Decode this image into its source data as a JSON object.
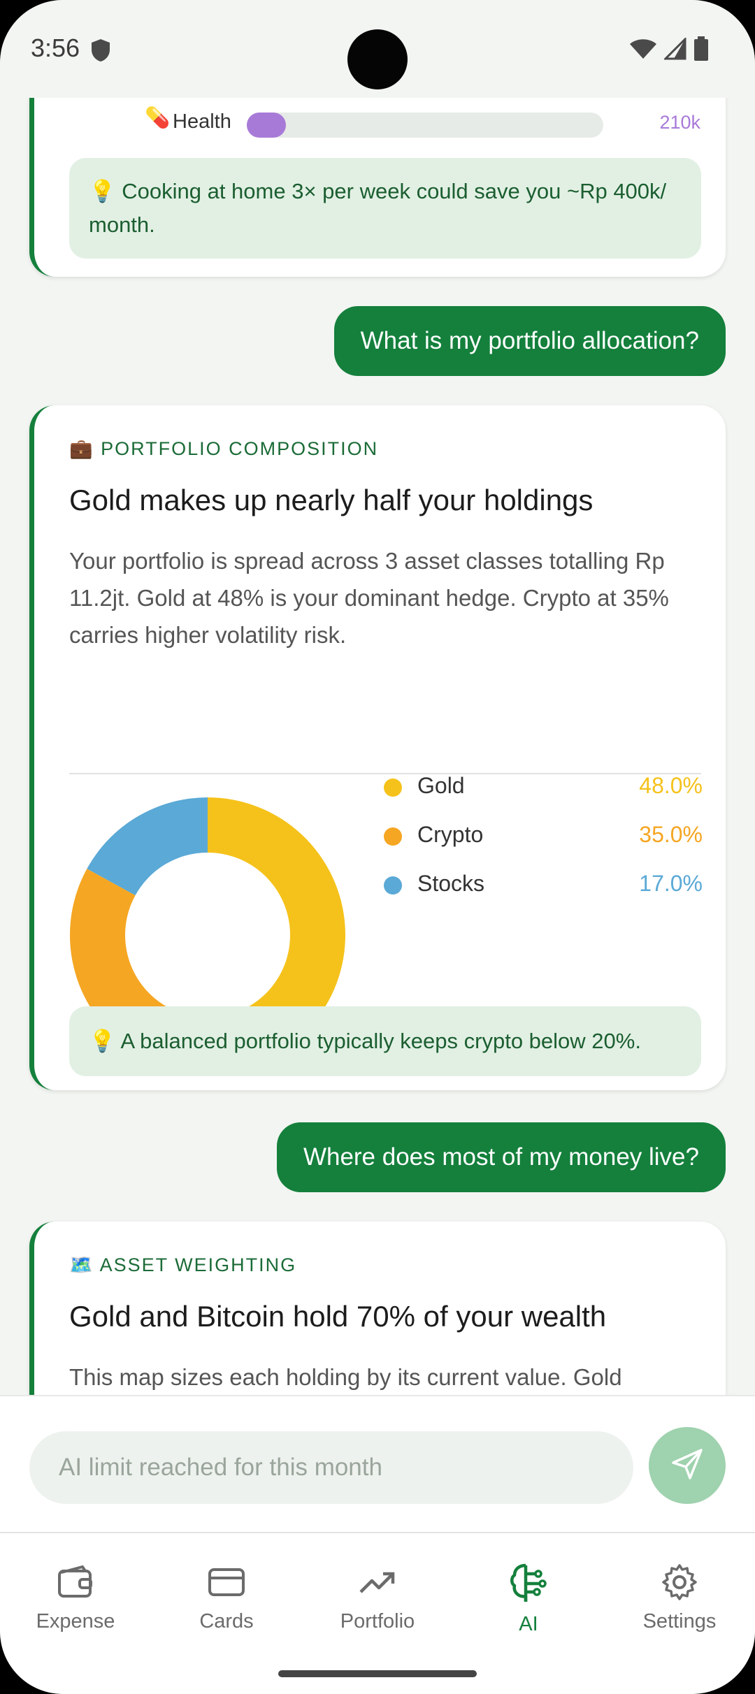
{
  "status": {
    "time": "3:56"
  },
  "top_card": {
    "category_icon": "pill-icon",
    "category_label": "Health",
    "category_amount": "210k",
    "category_fill": 0.11,
    "category_color": "#a87ad8",
    "tip_icon": "💡",
    "tip_text": "Cooking at home 3× per week could save you ~Rp 400k/ month."
  },
  "messages": {
    "user_1": "What is my portfolio allocation?",
    "user_2": "Where does most of my money live?"
  },
  "portfolio_card": {
    "eyebrow_icon": "💼",
    "eyebrow": "PORTFOLIO COMPOSITION",
    "title": "Gold makes up nearly half your holdings",
    "body": "Your portfolio is spread across 3 asset classes totalling Rp 11.2jt. Gold at 48% is your dominant hedge. Crypto at 35% carries higher volatility risk.",
    "tip_icon": "💡",
    "tip_text": "A balanced portfolio typically keeps crypto below 20%."
  },
  "chart_data": {
    "type": "pie",
    "donut": true,
    "categories": [
      "Gold",
      "Crypto",
      "Stocks"
    ],
    "values": [
      48.0,
      35.0,
      17.0
    ],
    "value_labels": [
      "48.0%",
      "35.0%",
      "17.0%"
    ],
    "colors": [
      "#f5c21b",
      "#f5a623",
      "#5aa9d6"
    ],
    "legend_position": "right"
  },
  "asset_card": {
    "eyebrow_icon": "🗺️",
    "eyebrow": "ASSET WEIGHTING",
    "title": "Gold and Bitcoin hold 70% of your wealth",
    "body": "This map sizes each holding by its current value. Gold"
  },
  "input": {
    "placeholder": "AI limit reached for this month"
  },
  "nav": {
    "items": [
      {
        "label": "Expense",
        "icon": "wallet-icon"
      },
      {
        "label": "Cards",
        "icon": "card-icon"
      },
      {
        "label": "Portfolio",
        "icon": "trending-up-icon"
      },
      {
        "label": "AI",
        "icon": "brain-icon"
      },
      {
        "label": "Settings",
        "icon": "gear-icon"
      }
    ],
    "active": "AI"
  },
  "colors": {
    "accent": "#14803c",
    "tip_bg": "#e2f0e4",
    "send_disabled": "#9fd2ae"
  }
}
